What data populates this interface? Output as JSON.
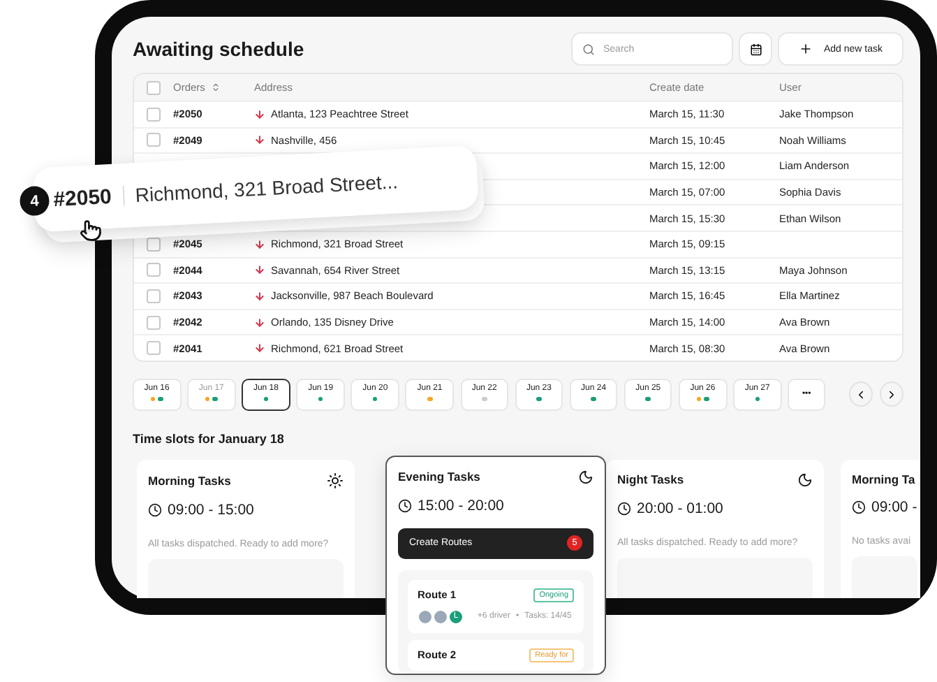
{
  "header": {
    "title": "Awaiting schedule",
    "search": {
      "placeholder": "Search"
    },
    "add_button": "Add new task"
  },
  "table": {
    "all_checked": false,
    "columns": [
      "Orders",
      "Address",
      "Create date",
      "User"
    ],
    "rows": [
      {
        "order": "#2050",
        "address": "Atlanta, 123 Peachtree Street",
        "date": "March 15, 11:30",
        "user": "Jake Thompson",
        "checked": false
      },
      {
        "order": "#2049",
        "address": "Nashville, 456",
        "date": "March 15, 10:45",
        "user": "Noah Williams",
        "checked": false
      },
      {
        "date": "March 15, 12:00",
        "user": "Liam Anderson"
      },
      {
        "date": "March 15, 07:00",
        "user": "Sophia Davis"
      },
      {
        "date": "March 15, 15:30",
        "user": "Ethan Wilson"
      },
      {
        "order": "#2045",
        "address": "Richmond, 321 Broad Street",
        "date": "March 15, 09:15",
        "checked": false
      },
      {
        "order": "#2044",
        "address": "Savannah, 654 River Street",
        "date": "March 15, 13:15",
        "user": "Maya Johnson",
        "checked": false
      },
      {
        "order": "#2043",
        "address": "Jacksonville, 987 Beach Boulevard",
        "date": "March 15, 16:45",
        "user": "Ella Martinez",
        "checked": false
      },
      {
        "order": "#2042",
        "address": "Orlando, 135 Disney Drive",
        "date": "March 15, 14:00",
        "user": "Ava Brown",
        "checked": false
      },
      {
        "order": "#2041",
        "address": "Richmond, 621 Broad Street",
        "date": "March 15, 08:30",
        "user": "Ava Brown",
        "checked": false
      }
    ]
  },
  "drag_preview": {
    "count": "4",
    "order": "#2050",
    "address": "Richmond, 321 Broad Street..."
  },
  "dates": [
    {
      "label": "Jun 16",
      "selected": false,
      "muted": false,
      "dots": [
        {
          "color": "#f5a623"
        },
        {
          "color": "#1a9e7a"
        }
      ]
    },
    {
      "label": "Jun 17",
      "selected": false,
      "muted": true,
      "dots": [
        {
          "color": "#f5a623"
        },
        {
          "color": "#1a9e7a"
        }
      ]
    },
    {
      "label": "Jun 18",
      "selected": true,
      "muted": false,
      "dots": [
        {
          "color": "#1a9e7a"
        }
      ]
    },
    {
      "label": "Jun 19",
      "selected": false,
      "muted": false,
      "dots": [
        {
          "color": "#1a9e7a"
        }
      ]
    },
    {
      "label": "Jun 20",
      "selected": false,
      "muted": false,
      "dots": [
        {
          "color": "#1a9e7a"
        }
      ]
    },
    {
      "label": "Jun 21",
      "selected": false,
      "muted": false,
      "dots": [
        {
          "color": "#f5a623"
        }
      ]
    },
    {
      "label": "Jun 22",
      "selected": false,
      "muted": false,
      "dots": [
        {
          "color": "#cccccc"
        }
      ]
    },
    {
      "label": "Jun 23",
      "selected": false,
      "muted": false,
      "dots": [
        {
          "color": "#1a9e7a"
        }
      ]
    },
    {
      "label": "Jun 24",
      "selected": false,
      "muted": false,
      "dots": [
        {
          "color": "#1a9e7a"
        }
      ]
    },
    {
      "label": "Jun 25",
      "selected": false,
      "muted": false,
      "dots": [
        {
          "color": "#1a9e7a"
        }
      ]
    },
    {
      "label": "Jun 26",
      "selected": false,
      "muted": false,
      "dots": [
        {
          "color": "#f5a623"
        },
        {
          "color": "#1a9e7a"
        }
      ]
    },
    {
      "label": "Jun 27",
      "selected": false,
      "muted": false,
      "dots": [
        {
          "color": "#1a9e7a"
        }
      ]
    }
  ],
  "more_dates": "•••",
  "time_slots": {
    "title": "Time slots for January 18",
    "slots": [
      {
        "title": "Morning Tasks",
        "kind": "day",
        "time": "09:00 - 15:00",
        "message": "All tasks dispatched. Ready to add more?",
        "selected": false
      },
      {
        "title": "Evening Tasks",
        "kind": "night",
        "time": "15:00 - 20:00",
        "selected": true,
        "routes_button": {
          "label": "Create Routes",
          "count": "5"
        },
        "routes": [
          {
            "name": "Route 1",
            "status": "Ongoing",
            "kind": "ongoing",
            "avatar_initial": "L",
            "drivers": "+6 driver",
            "separator": "•",
            "tasks": "Tasks: 14/45"
          },
          {
            "name": "Route 2",
            "status": "Ready for",
            "kind": "ready"
          }
        ]
      },
      {
        "title": "Night Tasks",
        "kind": "night",
        "time": "20:00 - 01:00",
        "message": "All tasks dispatched. Ready to add more?",
        "selected": false
      },
      {
        "title": "Morning Ta",
        "kind": "partial",
        "time": "09:00 -",
        "message": "No tasks avai",
        "selected": false
      }
    ]
  }
}
